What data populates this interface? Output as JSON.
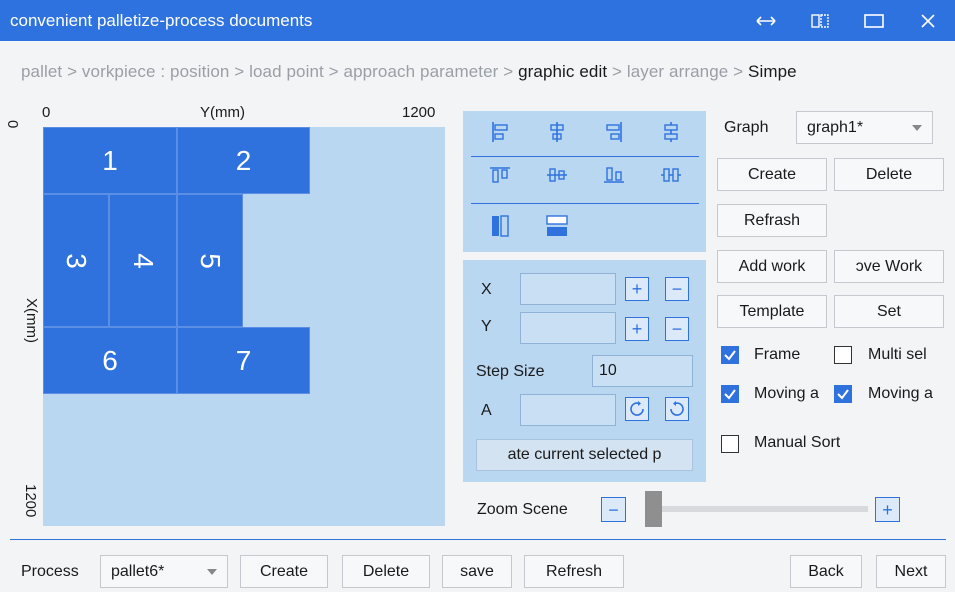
{
  "window": {
    "title": "convenient palletize-process documents"
  },
  "breadcrumb": {
    "before": "pallet > vorkpiece : position > load point > approach parameter > ",
    "current": "graphic edit",
    "after": " > layer arrange > ",
    "last": "Simpe"
  },
  "scene": {
    "y_axis_label": "Y(mm)",
    "x_axis_label": "X(mm)",
    "y_min": "0",
    "y_max": "1200",
    "x_min": "0",
    "x_max": "1200",
    "blocks": [
      "1",
      "2",
      "3",
      "4",
      "5",
      "6",
      "7"
    ]
  },
  "graph": {
    "label": "Graph",
    "selected": "graph1*",
    "create_label": "Create",
    "delete_label": "Delete",
    "refresh_label": "Refrash",
    "add_work_label": "Add work",
    "remove_work_label": "ɔve Work",
    "template_label": "Template",
    "set_label": "Set"
  },
  "options": {
    "frame": {
      "label": "Frame",
      "checked": true
    },
    "multi_select": {
      "label": "Multi sel",
      "checked": false
    },
    "moving_a1": {
      "label": "Moving a",
      "checked": true
    },
    "moving_a2": {
      "label": "Moving a",
      "checked": true
    },
    "manual_sort": {
      "label": "Manual Sort",
      "checked": false
    }
  },
  "position": {
    "x_label": "X",
    "y_label": "Y",
    "x_value": "",
    "y_value": "",
    "step_label": "Step Size",
    "step_value": "10",
    "a_label": "A",
    "a_value": "",
    "rotate_button_label": "ate current selected p"
  },
  "zoom": {
    "label": "Zoom Scene",
    "minus": "−",
    "plus": "+",
    "level": 0
  },
  "footer": {
    "process_label": "Process",
    "process_value": "pallet6*",
    "create_label": "Create",
    "delete_label": "Delete",
    "save_label": "save",
    "refresh_label": "Refresh",
    "back_label": "Back",
    "next_label": "Next"
  },
  "colors": {
    "accent": "#2e72e0",
    "canvas": "#bad7f2",
    "block": "#2f72de"
  }
}
